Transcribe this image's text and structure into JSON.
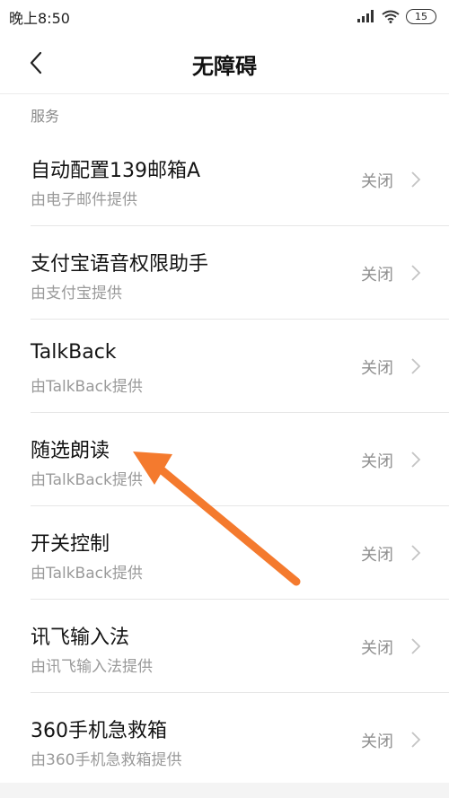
{
  "status_bar": {
    "time": "晚上8:50",
    "battery": "15",
    "icons": [
      "signal-icon",
      "wifi-icon",
      "battery-icon"
    ]
  },
  "header": {
    "title": "无障碍",
    "back_icon": "chevron-left-icon"
  },
  "section": {
    "title": "服务"
  },
  "items": [
    {
      "title": "自动配置139邮箱A",
      "subtitle": "由电子邮件提供",
      "status": "关闭"
    },
    {
      "title": "支付宝语音权限助手",
      "subtitle": "由支付宝提供",
      "status": "关闭"
    },
    {
      "title": "TalkBack",
      "subtitle": "由TalkBack提供",
      "status": "关闭"
    },
    {
      "title": "随选朗读",
      "subtitle": "由TalkBack提供",
      "status": "关闭"
    },
    {
      "title": "开关控制",
      "subtitle": "由TalkBack提供",
      "status": "关闭"
    },
    {
      "title": "讯飞输入法",
      "subtitle": "由讯飞输入法提供",
      "status": "关闭"
    },
    {
      "title": "360手机急救箱",
      "subtitle": "由360手机急救箱提供",
      "status": "关闭"
    }
  ],
  "colors": {
    "annotation_arrow": "#f47a2e",
    "secondary_text": "#9a9a9a",
    "divider": "#e6e6e6"
  }
}
